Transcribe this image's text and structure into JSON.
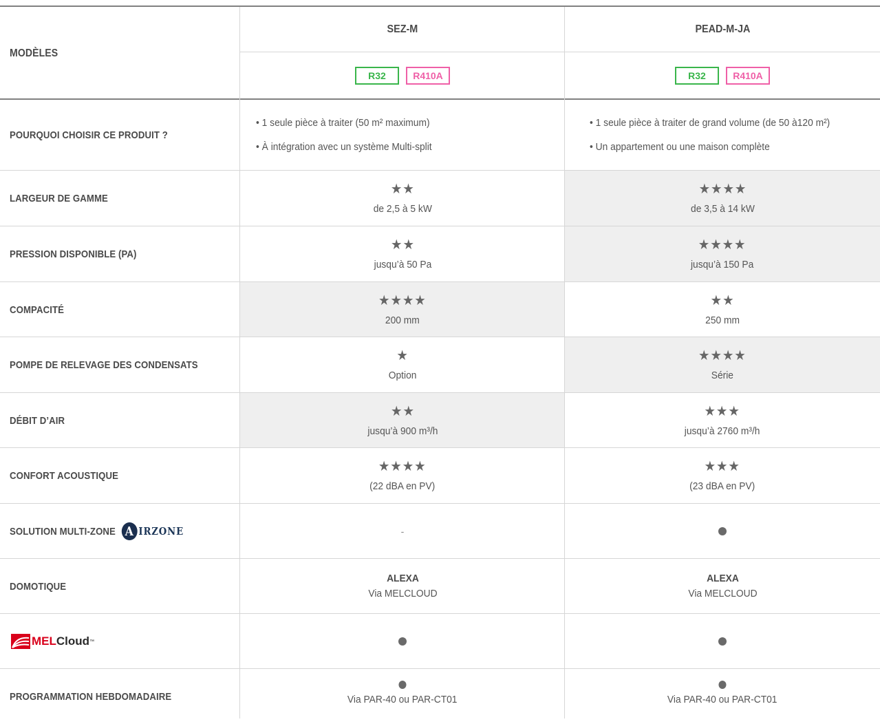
{
  "header": {
    "models_label": "MODÈLES",
    "col1": {
      "title": "SEZ-M",
      "refrigerants": [
        "R32",
        "R410A"
      ]
    },
    "col2": {
      "title": "PEAD-M-JA",
      "refrigerants": [
        "R32",
        "R410A"
      ]
    }
  },
  "rows": {
    "why": {
      "label": "POURQUOI CHOISIR CE PRODUIT ?",
      "col1": [
        "• 1 seule pièce à traiter (50 m² maximum)",
        "• À intégration avec un système Multi-split"
      ],
      "col2": [
        "• 1 seule pièce à traiter de grand volume (de 50 à120 m²)",
        "• Un appartement ou une maison complète"
      ]
    },
    "range": {
      "label": "LARGEUR DE GAMME",
      "col1_stars": "★★",
      "col1_text": "de 2,5 à 5 kW",
      "col2_stars": "★★★★",
      "col2_text": "de 3,5 à 14 kW",
      "col1_rating": 2,
      "col2_rating": 4
    },
    "pressure": {
      "label": "PRESSION DISPONIBLE (PA)",
      "col1_stars": "★★",
      "col1_text": "jusqu’à 50 Pa",
      "col2_stars": "★★★★",
      "col2_text": "jusqu’à 150 Pa",
      "col1_rating": 2,
      "col2_rating": 4
    },
    "compact": {
      "label": "COMPACITÉ",
      "col1_stars": "★★★★",
      "col1_text": "200 mm",
      "col2_stars": "★★",
      "col2_text": "250 mm",
      "col1_rating": 4,
      "col2_rating": 2
    },
    "pump": {
      "label": "POMPE DE RELEVAGE DES CONDENSATS",
      "col1_stars": "★",
      "col1_text": "Option",
      "col2_stars": "★★★★",
      "col2_text": "Série",
      "col1_rating": 1,
      "col2_rating": 4
    },
    "airflow": {
      "label": "DÉBIT D’AIR",
      "col1_stars": "★★",
      "col1_text": "jusqu’à 900 m³/h",
      "col2_stars": "★★★",
      "col2_text": "jusqu’à 2760 m³/h",
      "col1_rating": 2,
      "col2_rating": 3
    },
    "acoustic": {
      "label": "CONFORT ACOUSTIQUE",
      "col1_stars": "★★★★",
      "col1_text": "(22 dBA en PV)",
      "col2_stars": "★★★",
      "col2_text": "(23 dBA en PV)",
      "col1_rating": 4,
      "col2_rating": 3
    },
    "multizone": {
      "label": "SOLUTION MULTI-ZONE",
      "logo_letter": "A",
      "logo_text": "IRZONE",
      "col1_text": "-",
      "col2_dot": true
    },
    "domotique": {
      "label": "DOMOTIQUE",
      "col1_title": "ALEXA",
      "col1_text": "Via MELCLOUD",
      "col2_title": "ALEXA",
      "col2_text": "Via MELCLOUD"
    },
    "melcloud": {
      "logo_mel": "MEL",
      "logo_cloud": "Cloud",
      "logo_tm": "™",
      "col1_dot": true,
      "col2_dot": true
    },
    "weekly": {
      "label": "PROGRAMMATION HEBDOMADAIRE",
      "col1_text": "Via PAR-40 ou PAR-CT01",
      "col2_text": "Via PAR-40 ou PAR-CT01"
    }
  },
  "colors": {
    "r32": "#39b54a",
    "r410a": "#ef5fa7",
    "shade": "#efefef",
    "airzone": "#1b2f4f",
    "mel_red": "#d9001b"
  }
}
